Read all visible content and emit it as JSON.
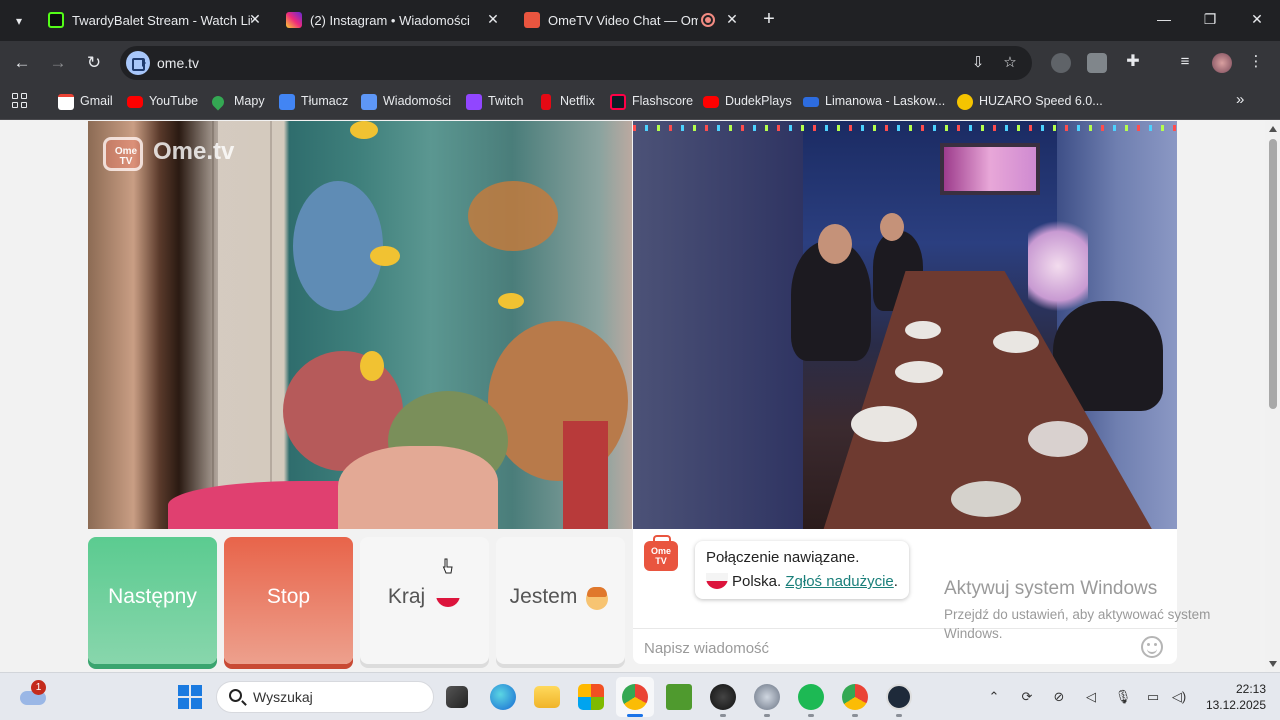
{
  "browser": {
    "tabs": [
      {
        "title": "TwardyBalet Stream - Watch Live",
        "favicon": "kick-icon",
        "color": "#53fc18"
      },
      {
        "title": "(2) Instagram • Wiadomości",
        "favicon": "instagram-icon",
        "color": "#e1306c"
      },
      {
        "title": "OmeTV Video Chat — Ome",
        "favicon": "ometv-icon",
        "color": "#e9553f",
        "active": true,
        "recording": true
      }
    ],
    "url": "ome.tv",
    "bookmarks": [
      {
        "label": "Gmail",
        "icon": "gmail-icon",
        "color": "#ea4335"
      },
      {
        "label": "YouTube",
        "icon": "youtube-icon",
        "color": "#ff0000"
      },
      {
        "label": "Mapy",
        "icon": "maps-icon",
        "color": "#34a853"
      },
      {
        "label": "Tłumacz",
        "icon": "translate-icon",
        "color": "#4285f4"
      },
      {
        "label": "Wiadomości",
        "icon": "news-icon",
        "color": "#5e97f6"
      },
      {
        "label": "Twitch",
        "icon": "twitch-icon",
        "color": "#9146ff"
      },
      {
        "label": "Netflix",
        "icon": "netflix-icon",
        "color": "#e50914"
      },
      {
        "label": "Flashscore",
        "icon": "flashscore-icon",
        "color": "#ff0046"
      },
      {
        "label": "DudekPlays",
        "icon": "youtube-icon",
        "color": "#ff0000"
      },
      {
        "label": "Limanowa - Laskow...",
        "icon": "bus-icon",
        "color": "#2d6cdf"
      },
      {
        "label": "HUZARO Speed 6.0...",
        "icon": "huzaro-icon",
        "color": "#f5c400"
      }
    ]
  },
  "ometv": {
    "logo": "Ome.tv",
    "logo_badge": "Ome\nTV",
    "buttons": {
      "next": "Następny",
      "stop": "Stop",
      "country": "Kraj",
      "i_am": "Jestem"
    },
    "chat": {
      "connected": "Połączenie nawiązane.",
      "country": "Polska.",
      "report": "Zgłoś nadużycie",
      "report_suffix": ".",
      "input_placeholder": "Napisz wiadomość"
    }
  },
  "windows_activation": {
    "title": "Aktywuj system Windows",
    "subtitle": "Przejdź do ustawień, aby aktywować system Windows."
  },
  "taskbar": {
    "search_placeholder": "Wyszukaj",
    "weather_badge": "1",
    "time": "22:13",
    "date": "13.12.2025"
  }
}
